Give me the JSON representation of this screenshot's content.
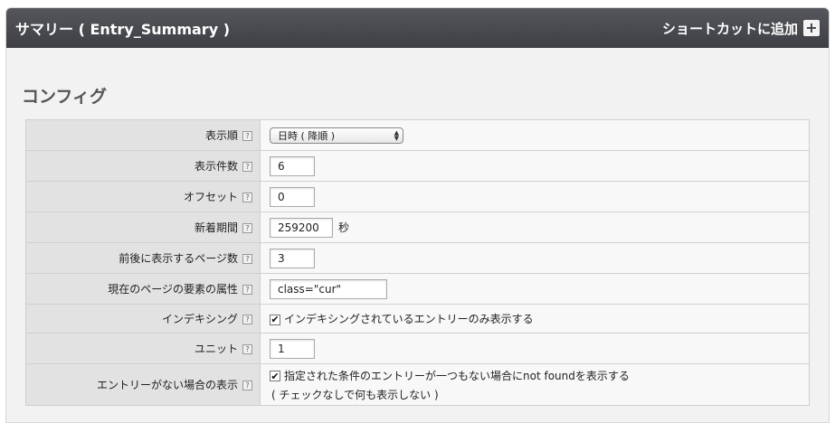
{
  "header": {
    "title": "サマリー ( Entry_Summary )",
    "shortcut_label": "ショートカットに追加",
    "plus_icon": "+"
  },
  "section_title": "コンフィグ",
  "help_glyph": "?",
  "check_glyph": "✔",
  "updown_glyph_up": "▲",
  "updown_glyph_down": "▼",
  "rows": [
    {
      "label": "表示順",
      "select_value": "日時 ( 降順 )"
    },
    {
      "label": "表示件数",
      "value": "6"
    },
    {
      "label": "オフセット",
      "value": "0"
    },
    {
      "label": "新着期間",
      "value": "259200",
      "unit": "秒"
    },
    {
      "label": "前後に表示するページ数",
      "value": "3"
    },
    {
      "label": "現在のページの要素の属性",
      "value": "class=\"cur\""
    },
    {
      "label": "インデキシング",
      "checkbox_label": "インデキシングされているエントリーのみ表示する",
      "checked": true
    },
    {
      "label": "ユニット",
      "value": "1"
    },
    {
      "label": "エントリーがない場合の表示",
      "checkbox_label": "指定された条件のエントリーが一つもない場合にnot foundを表示する",
      "checked": true,
      "note": "( チェックなしで何も表示しない )"
    }
  ]
}
